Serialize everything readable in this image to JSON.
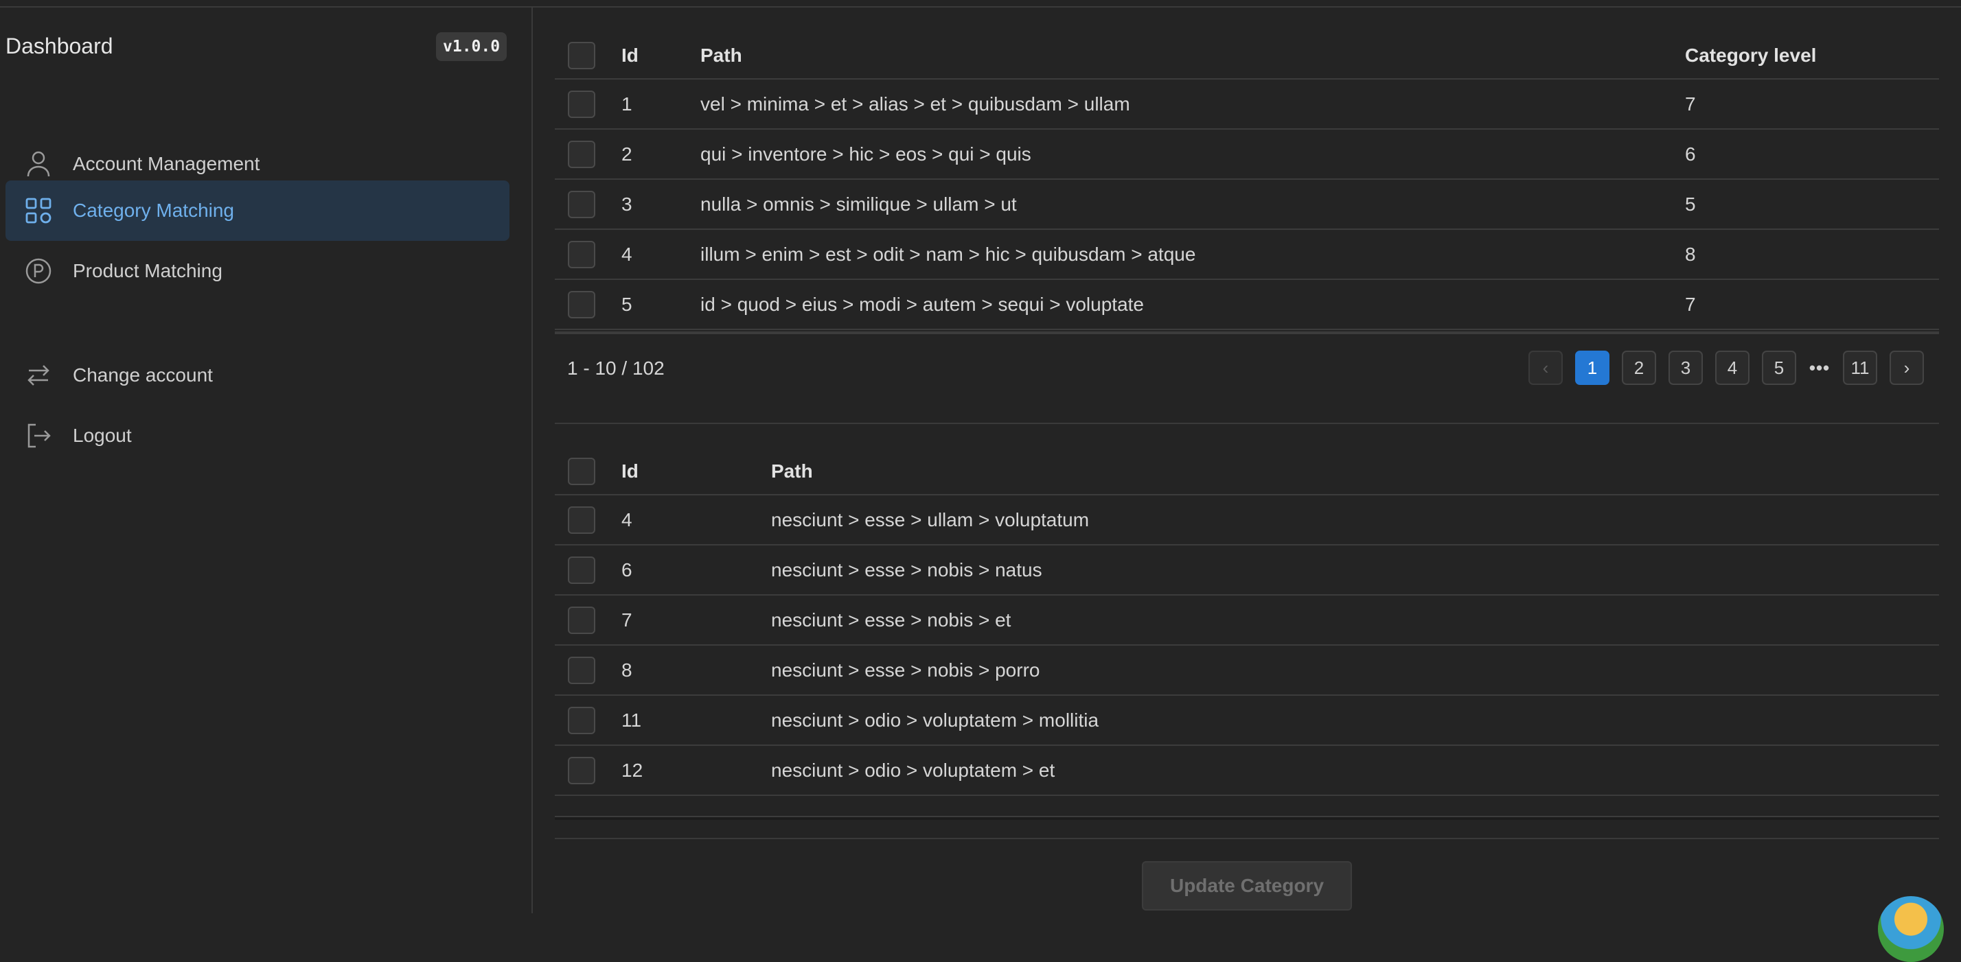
{
  "sidebar": {
    "brand": "Dashboard",
    "version": "v1.0.0",
    "items": [
      {
        "label": "Account Management",
        "icon": "user-icon",
        "active": false
      },
      {
        "label": "Category Matching",
        "icon": "grid-icon",
        "active": true
      },
      {
        "label": "Product Matching",
        "icon": "p-circle-icon",
        "active": false
      }
    ],
    "secondary": [
      {
        "label": "Change account",
        "icon": "swap-arrows-icon"
      },
      {
        "label": "Logout",
        "icon": "logout-icon"
      }
    ]
  },
  "categories_table": {
    "headers": {
      "id": "Id",
      "path": "Path",
      "level": "Category level"
    },
    "rows": [
      {
        "id": "1",
        "path": "vel > minima > et > alias > et > quibusdam > ullam",
        "level": "7"
      },
      {
        "id": "2",
        "path": "qui > inventore > hic > eos > qui > quis",
        "level": "6"
      },
      {
        "id": "3",
        "path": "nulla > omnis > similique > ullam > ut",
        "level": "5"
      },
      {
        "id": "4",
        "path": "illum > enim > est > odit > nam > hic > quibusdam > atque",
        "level": "8"
      },
      {
        "id": "5",
        "path": "id > quod > eius > modi > autem > sequi > voluptate",
        "level": "7"
      }
    ]
  },
  "pagination": {
    "info": "1 - 10 / 102",
    "prev": "‹",
    "next": "›",
    "pages": [
      "1",
      "2",
      "3",
      "4",
      "5"
    ],
    "current": "1",
    "ellipsis": "•••",
    "last": "11"
  },
  "matching_table": {
    "headers": {
      "id": "Id",
      "path": "Path"
    },
    "rows": [
      {
        "id": "4",
        "path": "nesciunt > esse > ullam > voluptatum"
      },
      {
        "id": "6",
        "path": "nesciunt > esse > nobis > natus"
      },
      {
        "id": "7",
        "path": "nesciunt > esse > nobis > et"
      },
      {
        "id": "8",
        "path": "nesciunt > esse > nobis > porro"
      },
      {
        "id": "11",
        "path": "nesciunt > odio > voluptatem > mollitia"
      },
      {
        "id": "12",
        "path": "nesciunt > odio > voluptatem > et"
      }
    ]
  },
  "actions": {
    "update_label": "Update Category"
  },
  "colors": {
    "accent": "#2478d4",
    "active_nav_bg": "#253546",
    "active_nav_text": "#6fb0ec",
    "background": "#242424"
  }
}
